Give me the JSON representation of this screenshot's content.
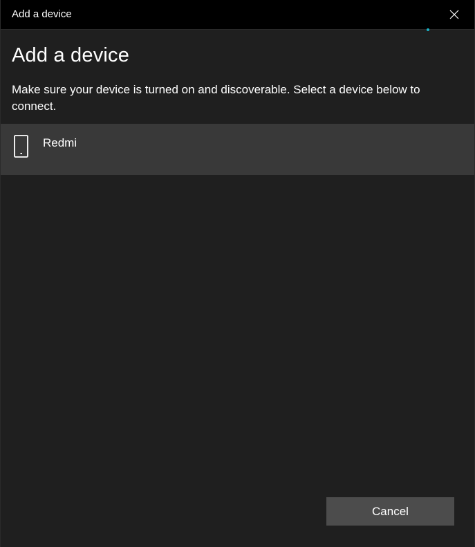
{
  "window": {
    "title": "Add a device",
    "close_icon": "close-icon"
  },
  "content": {
    "heading": "Add a device",
    "instructions": "Make sure your device is turned on and discoverable. Select a device below to connect."
  },
  "devices": [
    {
      "name": "Redmi",
      "icon": "phone-icon"
    }
  ],
  "footer": {
    "cancel_label": "Cancel"
  },
  "colors": {
    "background": "#1f1f1f",
    "titlebar": "#000000",
    "device_row": "#393939",
    "button": "#4c4c4c",
    "accent": "#1ab3c7"
  }
}
